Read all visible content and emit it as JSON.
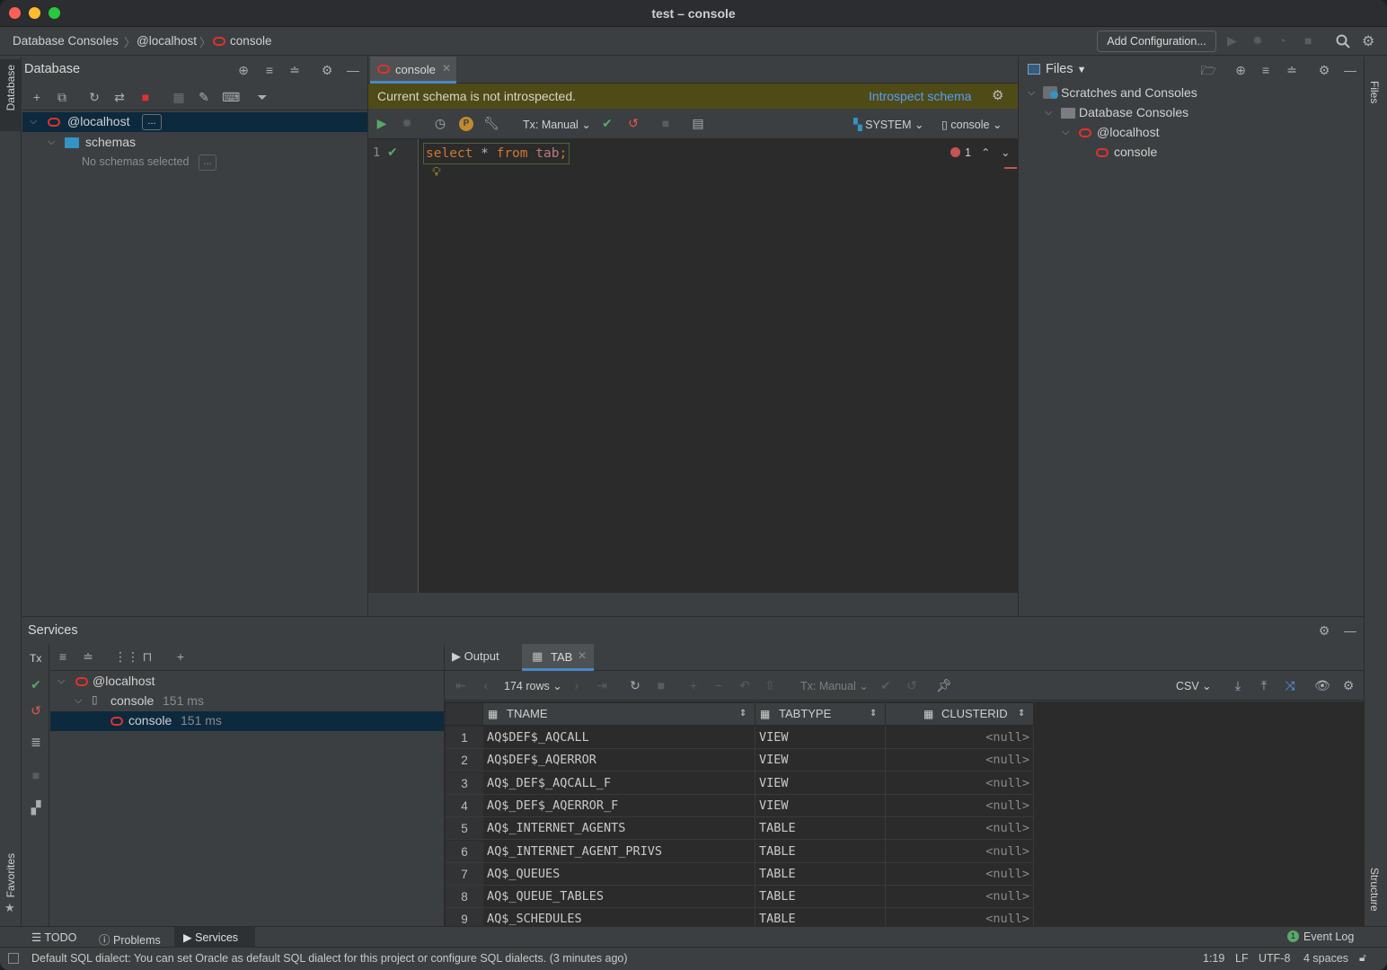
{
  "window": {
    "title": "test – console"
  },
  "breadcrumbs": [
    "Database Consoles",
    "@localhost",
    "console"
  ],
  "toolbar": {
    "add_config": "Add Configuration..."
  },
  "left_strip": {
    "database": "Database",
    "favorites": "Favorites"
  },
  "right_strip": {
    "files": "Files",
    "structure": "Structure"
  },
  "database_panel": {
    "title": "Database",
    "tree": {
      "connection": "@localhost",
      "ellipsis": "...",
      "schemas": "schemas",
      "empty": "No schemas selected",
      "empty_ellipsis": "..."
    }
  },
  "editor": {
    "tab": "console",
    "banner": {
      "message": "Current schema is not introspected.",
      "action": "Introspect schema"
    },
    "tx_mode": "Tx: Manual",
    "schema": "SYSTEM",
    "session": "console",
    "line_number": "1",
    "sql": {
      "kw1": "select",
      "star": " * ",
      "kw2": "from",
      "table": " tab",
      "semi": ";"
    },
    "error_count": "1"
  },
  "files_panel": {
    "title": "Files",
    "tree": [
      "Scratches and Consoles",
      "Database Consoles",
      "@localhost",
      "console"
    ]
  },
  "services": {
    "title": "Services",
    "tx_label": "Tx",
    "tree": {
      "connection": "@localhost",
      "session": {
        "label": "console",
        "time": "151 ms"
      },
      "console": {
        "label": "console",
        "time": "151 ms"
      }
    },
    "tabs": {
      "output": "Output",
      "tab": "TAB"
    },
    "rows_label": "174 rows",
    "tx_mode": "Tx: Manual",
    "export_format": "CSV",
    "columns": [
      "TNAME",
      "TABTYPE",
      "CLUSTERID"
    ],
    "rows": [
      {
        "n": "1",
        "tname": "AQ$DEF$_AQCALL",
        "tabtype": "VIEW",
        "clusterid": "<null>"
      },
      {
        "n": "2",
        "tname": "AQ$DEF$_AQERROR",
        "tabtype": "VIEW",
        "clusterid": "<null>"
      },
      {
        "n": "3",
        "tname": "AQ$_DEF$_AQCALL_F",
        "tabtype": "VIEW",
        "clusterid": "<null>"
      },
      {
        "n": "4",
        "tname": "AQ$_DEF$_AQERROR_F",
        "tabtype": "VIEW",
        "clusterid": "<null>"
      },
      {
        "n": "5",
        "tname": "AQ$_INTERNET_AGENTS",
        "tabtype": "TABLE",
        "clusterid": "<null>"
      },
      {
        "n": "6",
        "tname": "AQ$_INTERNET_AGENT_PRIVS",
        "tabtype": "TABLE",
        "clusterid": "<null>"
      },
      {
        "n": "7",
        "tname": "AQ$_QUEUES",
        "tabtype": "TABLE",
        "clusterid": "<null>"
      },
      {
        "n": "8",
        "tname": "AQ$_QUEUE_TABLES",
        "tabtype": "TABLE",
        "clusterid": "<null>"
      },
      {
        "n": "9",
        "tname": "AQ$_SCHEDULES",
        "tabtype": "TABLE",
        "clusterid": "<null>"
      }
    ]
  },
  "bottom_tabs": {
    "todo": "TODO",
    "problems": "Problems",
    "services": "Services",
    "event_log": "Event Log",
    "event_count": "1"
  },
  "status": {
    "message": "Default SQL dialect: You can set Oracle as default SQL dialect for this project or configure SQL dialects. (3 minutes ago)",
    "position": "1:19",
    "line_sep": "LF",
    "encoding": "UTF-8",
    "indent": "4 spaces"
  },
  "colors": {
    "accent": "#589df6",
    "oracle_red": "#e0322c",
    "run_green": "#59a869",
    "selection": "#0d293e"
  }
}
